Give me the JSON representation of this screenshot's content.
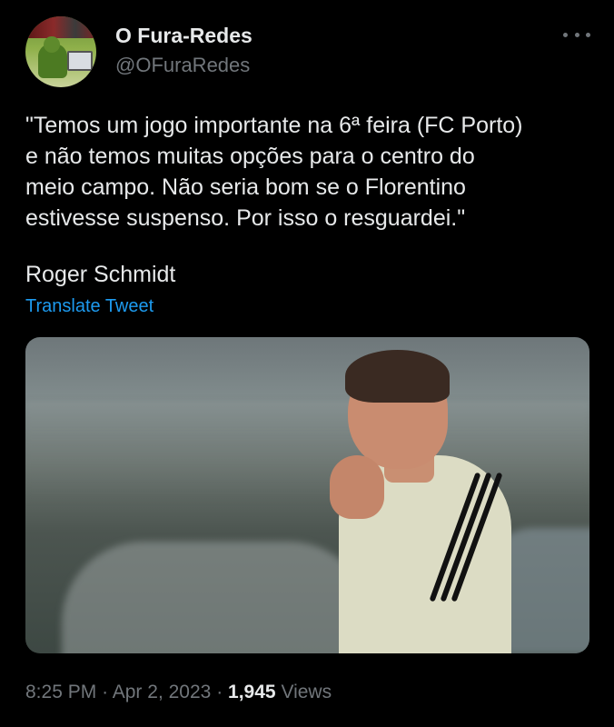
{
  "account": {
    "name": "O Fura-Redes",
    "handle": "@OFuraRedes",
    "more_icon": "more-horizontal-icon"
  },
  "tweet": {
    "text": "\"Temos um jogo importante na 6ª feira (FC Porto)\ne não temos muitas opções para o centro do\nmeio campo. Não seria bom se o Florentino\nestivesse suspenso. Por isso o resguardei.\"",
    "signature": "Roger Schmidt",
    "translate_label": "Translate Tweet",
    "time": "8:25 PM",
    "separator": "·",
    "date": "Apr 2, 2023",
    "views_count": "1,945",
    "views_label": "Views"
  },
  "colors": {
    "background": "#000000",
    "primary_text": "#e7e9ea",
    "secondary_text": "#71767b",
    "link": "#1d9bf0"
  }
}
